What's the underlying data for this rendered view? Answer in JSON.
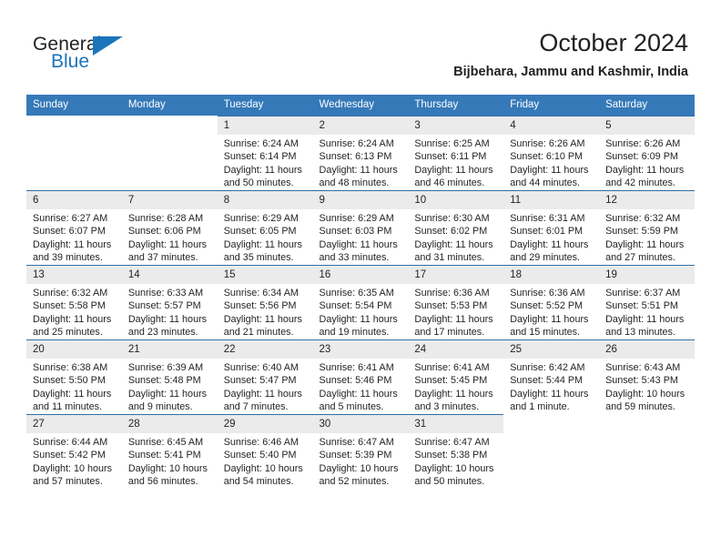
{
  "brand": {
    "name_dark": "General",
    "name_blue": "Blue",
    "accent_color": "#1b75bb"
  },
  "header": {
    "title": "October 2024",
    "subtitle": "Bijbehara, Jammu and Kashmir, India"
  },
  "theme": {
    "header_row_bg": "#3579b8",
    "day_number_bg": "#ebebeb",
    "row_rule": "#2f6fa8",
    "text": "#231f20"
  },
  "weekday_headers": [
    "Sunday",
    "Monday",
    "Tuesday",
    "Wednesday",
    "Thursday",
    "Friday",
    "Saturday"
  ],
  "labels": {
    "sunrise_prefix": "Sunrise:",
    "sunset_prefix": "Sunset:",
    "daylight_prefix": "Daylight:"
  },
  "weeks": [
    [
      {
        "empty": true
      },
      {
        "empty": true
      },
      {
        "day": "1",
        "sunrise": "Sunrise: 6:24 AM",
        "sunset": "Sunset: 6:14 PM",
        "daylight": "Daylight: 11 hours and 50 minutes."
      },
      {
        "day": "2",
        "sunrise": "Sunrise: 6:24 AM",
        "sunset": "Sunset: 6:13 PM",
        "daylight": "Daylight: 11 hours and 48 minutes."
      },
      {
        "day": "3",
        "sunrise": "Sunrise: 6:25 AM",
        "sunset": "Sunset: 6:11 PM",
        "daylight": "Daylight: 11 hours and 46 minutes."
      },
      {
        "day": "4",
        "sunrise": "Sunrise: 6:26 AM",
        "sunset": "Sunset: 6:10 PM",
        "daylight": "Daylight: 11 hours and 44 minutes."
      },
      {
        "day": "5",
        "sunrise": "Sunrise: 6:26 AM",
        "sunset": "Sunset: 6:09 PM",
        "daylight": "Daylight: 11 hours and 42 minutes."
      }
    ],
    [
      {
        "day": "6",
        "sunrise": "Sunrise: 6:27 AM",
        "sunset": "Sunset: 6:07 PM",
        "daylight": "Daylight: 11 hours and 39 minutes."
      },
      {
        "day": "7",
        "sunrise": "Sunrise: 6:28 AM",
        "sunset": "Sunset: 6:06 PM",
        "daylight": "Daylight: 11 hours and 37 minutes."
      },
      {
        "day": "8",
        "sunrise": "Sunrise: 6:29 AM",
        "sunset": "Sunset: 6:05 PM",
        "daylight": "Daylight: 11 hours and 35 minutes."
      },
      {
        "day": "9",
        "sunrise": "Sunrise: 6:29 AM",
        "sunset": "Sunset: 6:03 PM",
        "daylight": "Daylight: 11 hours and 33 minutes."
      },
      {
        "day": "10",
        "sunrise": "Sunrise: 6:30 AM",
        "sunset": "Sunset: 6:02 PM",
        "daylight": "Daylight: 11 hours and 31 minutes."
      },
      {
        "day": "11",
        "sunrise": "Sunrise: 6:31 AM",
        "sunset": "Sunset: 6:01 PM",
        "daylight": "Daylight: 11 hours and 29 minutes."
      },
      {
        "day": "12",
        "sunrise": "Sunrise: 6:32 AM",
        "sunset": "Sunset: 5:59 PM",
        "daylight": "Daylight: 11 hours and 27 minutes."
      }
    ],
    [
      {
        "day": "13",
        "sunrise": "Sunrise: 6:32 AM",
        "sunset": "Sunset: 5:58 PM",
        "daylight": "Daylight: 11 hours and 25 minutes."
      },
      {
        "day": "14",
        "sunrise": "Sunrise: 6:33 AM",
        "sunset": "Sunset: 5:57 PM",
        "daylight": "Daylight: 11 hours and 23 minutes."
      },
      {
        "day": "15",
        "sunrise": "Sunrise: 6:34 AM",
        "sunset": "Sunset: 5:56 PM",
        "daylight": "Daylight: 11 hours and 21 minutes."
      },
      {
        "day": "16",
        "sunrise": "Sunrise: 6:35 AM",
        "sunset": "Sunset: 5:54 PM",
        "daylight": "Daylight: 11 hours and 19 minutes."
      },
      {
        "day": "17",
        "sunrise": "Sunrise: 6:36 AM",
        "sunset": "Sunset: 5:53 PM",
        "daylight": "Daylight: 11 hours and 17 minutes."
      },
      {
        "day": "18",
        "sunrise": "Sunrise: 6:36 AM",
        "sunset": "Sunset: 5:52 PM",
        "daylight": "Daylight: 11 hours and 15 minutes."
      },
      {
        "day": "19",
        "sunrise": "Sunrise: 6:37 AM",
        "sunset": "Sunset: 5:51 PM",
        "daylight": "Daylight: 11 hours and 13 minutes."
      }
    ],
    [
      {
        "day": "20",
        "sunrise": "Sunrise: 6:38 AM",
        "sunset": "Sunset: 5:50 PM",
        "daylight": "Daylight: 11 hours and 11 minutes."
      },
      {
        "day": "21",
        "sunrise": "Sunrise: 6:39 AM",
        "sunset": "Sunset: 5:48 PM",
        "daylight": "Daylight: 11 hours and 9 minutes."
      },
      {
        "day": "22",
        "sunrise": "Sunrise: 6:40 AM",
        "sunset": "Sunset: 5:47 PM",
        "daylight": "Daylight: 11 hours and 7 minutes."
      },
      {
        "day": "23",
        "sunrise": "Sunrise: 6:41 AM",
        "sunset": "Sunset: 5:46 PM",
        "daylight": "Daylight: 11 hours and 5 minutes."
      },
      {
        "day": "24",
        "sunrise": "Sunrise: 6:41 AM",
        "sunset": "Sunset: 5:45 PM",
        "daylight": "Daylight: 11 hours and 3 minutes."
      },
      {
        "day": "25",
        "sunrise": "Sunrise: 6:42 AM",
        "sunset": "Sunset: 5:44 PM",
        "daylight": "Daylight: 11 hours and 1 minute."
      },
      {
        "day": "26",
        "sunrise": "Sunrise: 6:43 AM",
        "sunset": "Sunset: 5:43 PM",
        "daylight": "Daylight: 10 hours and 59 minutes."
      }
    ],
    [
      {
        "day": "27",
        "sunrise": "Sunrise: 6:44 AM",
        "sunset": "Sunset: 5:42 PM",
        "daylight": "Daylight: 10 hours and 57 minutes."
      },
      {
        "day": "28",
        "sunrise": "Sunrise: 6:45 AM",
        "sunset": "Sunset: 5:41 PM",
        "daylight": "Daylight: 10 hours and 56 minutes."
      },
      {
        "day": "29",
        "sunrise": "Sunrise: 6:46 AM",
        "sunset": "Sunset: 5:40 PM",
        "daylight": "Daylight: 10 hours and 54 minutes."
      },
      {
        "day": "30",
        "sunrise": "Sunrise: 6:47 AM",
        "sunset": "Sunset: 5:39 PM",
        "daylight": "Daylight: 10 hours and 52 minutes."
      },
      {
        "day": "31",
        "sunrise": "Sunrise: 6:47 AM",
        "sunset": "Sunset: 5:38 PM",
        "daylight": "Daylight: 10 hours and 50 minutes."
      },
      {
        "empty": true
      },
      {
        "empty": true
      }
    ]
  ]
}
